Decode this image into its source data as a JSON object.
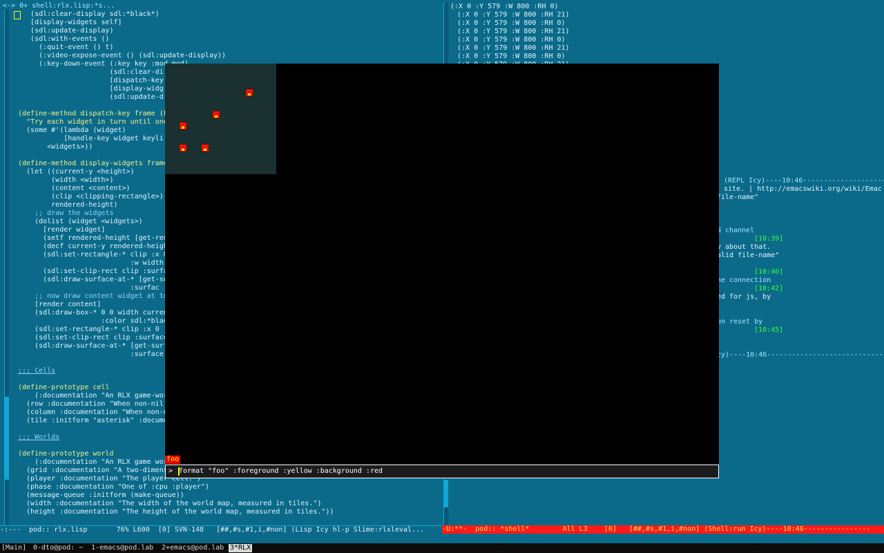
{
  "left_pane": {
    "header": "<-> 0+ shell:rlx.lisp:*s...",
    "lines": [
      "   (sdl:clear-display sdl:*black*)",
      "   [display-widgets self]",
      "   (sdl:update-display)",
      "   (sdl:with-events ()",
      "     (:quit-event () t)",
      "     (:video-expose-event () (sdl:update-display))",
      "     (:key-down-event (:key key :mod mod)",
      "                      (sdl:clear-di",
      "                      [dispatch-key",
      "                      [display-widg",
      "                      (sdl:update-d",
      "",
      "(define-method dispatch-key frame (k",
      "  \"Try each widget in turn until one",
      "  (some #'(lambda (widget)",
      "           [handle-key widget keyli",
      "       <widgets>))",
      "",
      "(define-method display-widgets frame",
      "  (let ((current-y <height>)",
      "        (width <width>)",
      "        (content <content>)",
      "        (clip <clipping-rectangle>)",
      "        rendered-height)",
      "    ;; draw the widgets",
      "    (dolist (widget <widgets>)",
      "      [render widget]",
      "      (setf rendered-height [get-ren",
      "      (decf current-y rendered-heigh",
      "      (sdl:set-rectangle-* clip :x 0",
      "                           :w width",
      "      (sdl:set-clip-rect clip :surfa",
      "      (sdl:draw-surface-at-* [get-su",
      "                           :surfac",
      "    ;; now draw content widget at to",
      "    [render content]",
      "    (sdl:draw-box-* 0 0 width curren",
      "                    :color sdl:*blac",
      "    (sdl:set-rectangle-* clip :x 0 :",
      "    (sdl:set-clip-rect clip :surface",
      "    (sdl:draw-surface-at-* [get-surf",
      "                           :surface",
      "",
      ";;; Cells",
      "",
      "(define-prototype cell",
      "    (:documentation \"An RLX game-wor",
      "  (row :documentation \"When non-nil,",
      "  (column :documentation \"When non-n",
      "  (tile :initform \"asterisk\" :docume",
      "",
      ";;; Worlds",
      "",
      "(define-prototype world",
      "    (:documentation \"An RLX game wor",
      "  (grid :documentation \"A two-dimens",
      "  (player :documentation \"The player cell.\")",
      "  (phase :documentation \"One of :cpu :player\")",
      "  (message-queue :initform (make-queue))",
      "  (width :documentation \"The width of the world map, measured in tiles.\")",
      "  (height :documentation \"The height of the world map, measured in tiles.\"))"
    ],
    "modeline": "-:---  pod:: rlx.lisp       76% L600  [0] SVN-148   [##,#s,#1,i,#non] (Lisp Icy hl-p Slime:rlxleval..."
  },
  "right_pane": {
    "header": "(:X 0 :Y 579 :W 800 :RH 0)",
    "geom_lines": [
      "(:X 0 :Y 579 :W 800 :RH 21)",
      "(:X 0 :Y 579 :W 800 :RH 0)",
      "(:X 0 :Y 579 :W 800 :RH 21)",
      "(:X 0 :Y 579 :W 800 :RH 0)",
      "(:X 0 :Y 579 :W 800 :RH 21)",
      "(:X 0 :Y 579 :W 800 :RH 0)",
      "(:X 0 :Y 579 :W 800 :RH 21)"
    ],
    "repl_divider": "(REPL Icy)----10:46---------------------",
    "irc_url": "site. | http://emacswiki.org/wiki/Emac",
    "fragments": [
      "file-name\"",
      "d channel",
      "[10:39]",
      "y about that.",
      "alid file-name\"",
      "[10:40]",
      "he connection",
      "[10:42]",
      "ed for js, by",
      "on reset by",
      "[10:45]",
      "cy)----10:46-------------------------------"
    ],
    "modeline": "-U:**-  pod:: *shell*        All L3    [0]   [##,#s,#1,i,#non] (Shell:run Icy)----10:46----------------"
  },
  "sdl_window": {
    "widget_label": "foo",
    "prompt_symbol": ">",
    "command_text": "format \"foo\" :foreground :yellow :background :red"
  },
  "taskbar": {
    "items": [
      "[Main]",
      "0-dto@pod: ~",
      "1-emacs@pod.lab",
      "2+emacs@pod.lab",
      "3*RLX"
    ]
  },
  "colors": {
    "background": "#0b6a8a",
    "keyword": "#f1f08a",
    "comment": "#8fd1ff",
    "timestamp": "#3bff3b",
    "modeline_active": "#ff1a1a"
  }
}
